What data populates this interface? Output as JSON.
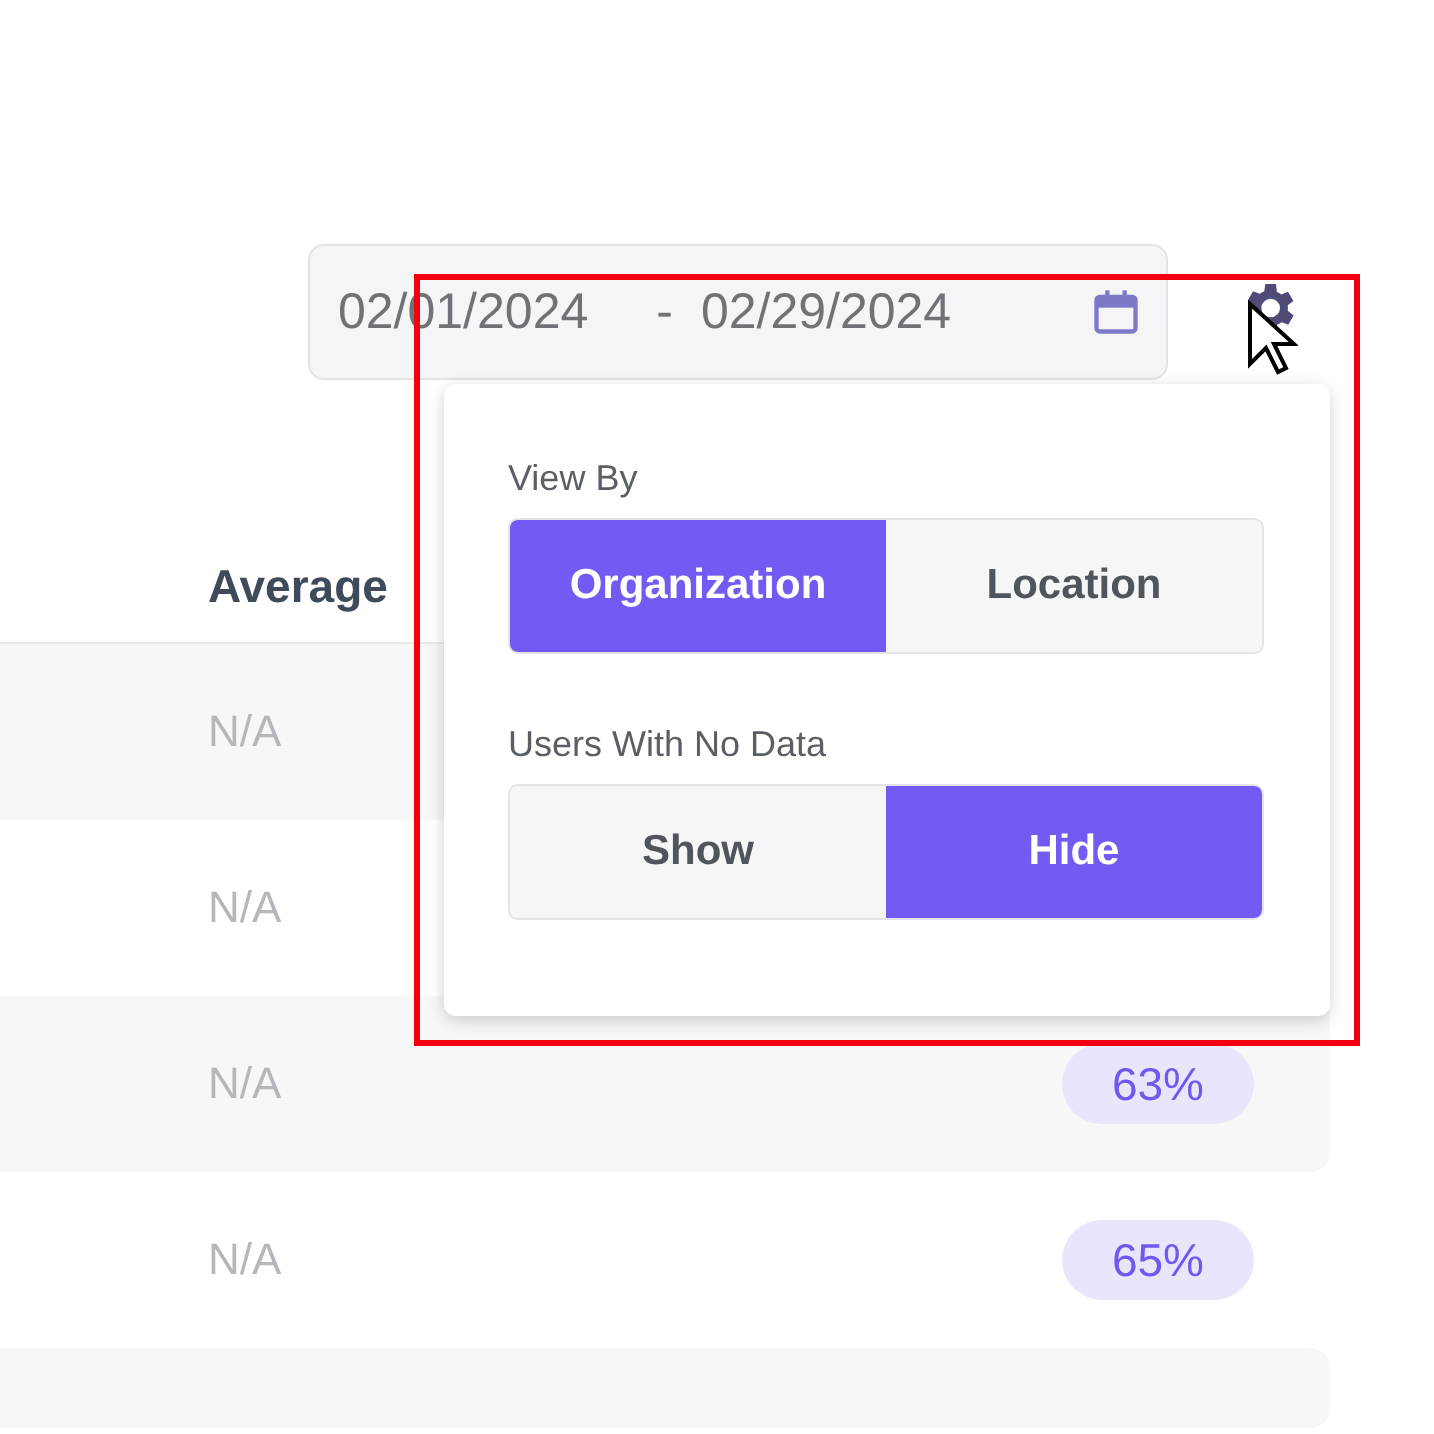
{
  "date_range": {
    "start": "02/01/2024",
    "separator": "-",
    "end": "02/29/2024"
  },
  "table": {
    "columns": [
      "Average"
    ],
    "rows": [
      {
        "average": "N/A"
      },
      {
        "average": "N/A"
      },
      {
        "average": "N/A",
        "percent": "63%"
      },
      {
        "average": "N/A",
        "percent": "65%"
      }
    ]
  },
  "settings_popover": {
    "groups": [
      {
        "label": "View By",
        "options": [
          {
            "label": "Organization",
            "selected": true
          },
          {
            "label": "Location",
            "selected": false
          }
        ]
      },
      {
        "label": "Users With No Data",
        "options": [
          {
            "label": "Show",
            "selected": false
          },
          {
            "label": "Hide",
            "selected": true
          }
        ]
      }
    ]
  }
}
